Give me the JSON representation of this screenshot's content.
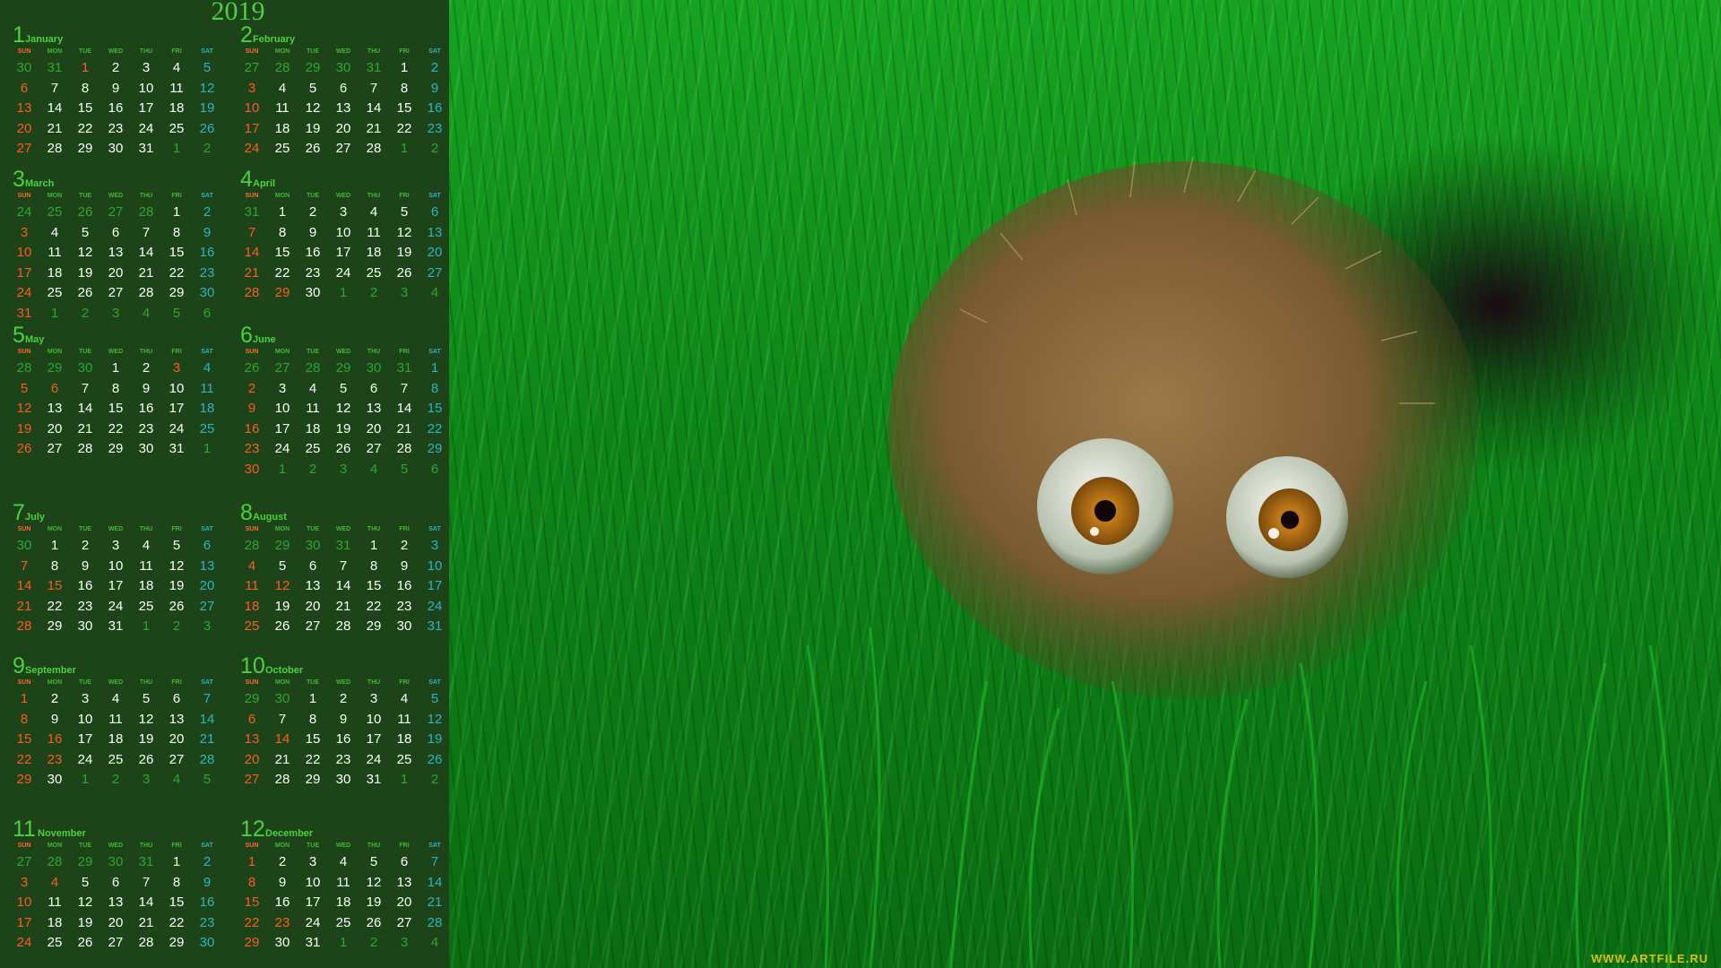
{
  "calendar": {
    "year": "2019",
    "weekdays": [
      "SUN",
      "MON",
      "TUE",
      "WED",
      "THU",
      "FRI",
      "SAT"
    ],
    "months": [
      {
        "num": "1",
        "name": "January",
        "weeks": [
          [
            "30",
            "31",
            "1",
            "2",
            "3",
            "4",
            "5"
          ],
          [
            "6",
            "7",
            "8",
            "9",
            "10",
            "11",
            "12"
          ],
          [
            "13",
            "14",
            "15",
            "16",
            "17",
            "18",
            "19"
          ],
          [
            "20",
            "21",
            "22",
            "23",
            "24",
            "25",
            "26"
          ],
          [
            "27",
            "28",
            "29",
            "30",
            "31",
            "1",
            "2"
          ]
        ]
      },
      {
        "num": "2",
        "name": "February",
        "weeks": [
          [
            "27",
            "28",
            "29",
            "30",
            "31",
            "1",
            "2"
          ],
          [
            "3",
            "4",
            "5",
            "6",
            "7",
            "8",
            "9"
          ],
          [
            "10",
            "11",
            "12",
            "13",
            "14",
            "15",
            "16"
          ],
          [
            "17",
            "18",
            "19",
            "20",
            "21",
            "22",
            "23"
          ],
          [
            "24",
            "25",
            "26",
            "27",
            "28",
            "1",
            "2"
          ]
        ]
      },
      {
        "num": "3",
        "name": "March",
        "weeks": [
          [
            "24",
            "25",
            "26",
            "27",
            "28",
            "1",
            "2"
          ],
          [
            "3",
            "4",
            "5",
            "6",
            "7",
            "8",
            "9"
          ],
          [
            "10",
            "11",
            "12",
            "13",
            "14",
            "15",
            "16"
          ],
          [
            "17",
            "18",
            "19",
            "20",
            "21",
            "22",
            "23"
          ],
          [
            "24",
            "25",
            "26",
            "27",
            "28",
            "29",
            "30"
          ],
          [
            "31",
            "1",
            "2",
            "3",
            "4",
            "5",
            "6"
          ]
        ]
      },
      {
        "num": "4",
        "name": "April",
        "weeks": [
          [
            "31",
            "1",
            "2",
            "3",
            "4",
            "5",
            "6"
          ],
          [
            "7",
            "8",
            "9",
            "10",
            "11",
            "12",
            "13"
          ],
          [
            "14",
            "15",
            "16",
            "17",
            "18",
            "19",
            "20"
          ],
          [
            "21",
            "22",
            "23",
            "24",
            "25",
            "26",
            "27"
          ],
          [
            "28",
            "29",
            "30",
            "1",
            "2",
            "3",
            "4"
          ]
        ]
      },
      {
        "num": "5",
        "name": "May",
        "weeks": [
          [
            "28",
            "29",
            "30",
            "1",
            "2",
            "3",
            "4"
          ],
          [
            "5",
            "6",
            "7",
            "8",
            "9",
            "10",
            "11"
          ],
          [
            "12",
            "13",
            "14",
            "15",
            "16",
            "17",
            "18"
          ],
          [
            "19",
            "20",
            "21",
            "22",
            "23",
            "24",
            "25"
          ],
          [
            "26",
            "27",
            "28",
            "29",
            "30",
            "31",
            "1"
          ]
        ]
      },
      {
        "num": "6",
        "name": "June",
        "weeks": [
          [
            "26",
            "27",
            "28",
            "29",
            "30",
            "31",
            "1"
          ],
          [
            "2",
            "3",
            "4",
            "5",
            "6",
            "7",
            "8"
          ],
          [
            "9",
            "10",
            "11",
            "12",
            "13",
            "14",
            "15"
          ],
          [
            "16",
            "17",
            "18",
            "19",
            "20",
            "21",
            "22"
          ],
          [
            "23",
            "24",
            "25",
            "26",
            "27",
            "28",
            "29"
          ],
          [
            "30",
            "1",
            "2",
            "3",
            "4",
            "5",
            "6"
          ]
        ]
      },
      {
        "num": "7",
        "name": "July",
        "weeks": [
          [
            "30",
            "1",
            "2",
            "3",
            "4",
            "5",
            "6"
          ],
          [
            "7",
            "8",
            "9",
            "10",
            "11",
            "12",
            "13"
          ],
          [
            "14",
            "15",
            "16",
            "17",
            "18",
            "19",
            "20"
          ],
          [
            "21",
            "22",
            "23",
            "24",
            "25",
            "26",
            "27"
          ],
          [
            "28",
            "29",
            "30",
            "31",
            "1",
            "2",
            "3"
          ]
        ]
      },
      {
        "num": "8",
        "name": "August",
        "weeks": [
          [
            "28",
            "29",
            "30",
            "31",
            "1",
            "2",
            "3"
          ],
          [
            "4",
            "5",
            "6",
            "7",
            "8",
            "9",
            "10"
          ],
          [
            "11",
            "12",
            "13",
            "14",
            "15",
            "16",
            "17"
          ],
          [
            "18",
            "19",
            "20",
            "21",
            "22",
            "23",
            "24"
          ],
          [
            "25",
            "26",
            "27",
            "28",
            "29",
            "30",
            "31"
          ]
        ]
      },
      {
        "num": "9",
        "name": "September",
        "weeks": [
          [
            "1",
            "2",
            "3",
            "4",
            "5",
            "6",
            "7"
          ],
          [
            "8",
            "9",
            "10",
            "11",
            "12",
            "13",
            "14"
          ],
          [
            "15",
            "16",
            "17",
            "18",
            "19",
            "20",
            "21"
          ],
          [
            "22",
            "23",
            "24",
            "25",
            "26",
            "27",
            "28"
          ],
          [
            "29",
            "30",
            "1",
            "2",
            "3",
            "4",
            "5"
          ]
        ]
      },
      {
        "num": "10",
        "name": "October",
        "weeks": [
          [
            "29",
            "30",
            "1",
            "2",
            "3",
            "4",
            "5"
          ],
          [
            "6",
            "7",
            "8",
            "9",
            "10",
            "11",
            "12"
          ],
          [
            "13",
            "14",
            "15",
            "16",
            "17",
            "18",
            "19"
          ],
          [
            "20",
            "21",
            "22",
            "23",
            "24",
            "25",
            "26"
          ],
          [
            "27",
            "28",
            "29",
            "30",
            "31",
            "1",
            "2"
          ]
        ]
      },
      {
        "num": "11",
        "name": "November",
        "weeks": [
          [
            "27",
            "28",
            "29",
            "30",
            "31",
            "1",
            "2"
          ],
          [
            "3",
            "4",
            "5",
            "6",
            "7",
            "8",
            "9"
          ],
          [
            "10",
            "11",
            "12",
            "13",
            "14",
            "15",
            "16"
          ],
          [
            "17",
            "18",
            "19",
            "20",
            "21",
            "22",
            "23"
          ],
          [
            "24",
            "25",
            "26",
            "27",
            "28",
            "29",
            "30"
          ]
        ]
      },
      {
        "num": "12",
        "name": "December",
        "weeks": [
          [
            "1",
            "2",
            "3",
            "4",
            "5",
            "6",
            "7"
          ],
          [
            "8",
            "9",
            "10",
            "11",
            "12",
            "13",
            "14"
          ],
          [
            "15",
            "16",
            "17",
            "18",
            "19",
            "20",
            "21"
          ],
          [
            "22",
            "23",
            "24",
            "25",
            "26",
            "27",
            "28"
          ],
          [
            "29",
            "30",
            "31",
            "1",
            "2",
            "3",
            "4"
          ]
        ]
      }
    ]
  },
  "illustration": {
    "subject": "furry-creature-icon"
  },
  "watermark": "WWW.ARTFILE.RU",
  "colors": {
    "panel": "#1c4418",
    "heading": "#4ad23c",
    "sunday": "#ff5a1e",
    "saturday": "#2ab4c8",
    "weekday": "#ffffff",
    "other_month": "#2fa532",
    "grass": "#14a01e",
    "fur": "#8a6a3a",
    "iris": "#c98a1e"
  }
}
